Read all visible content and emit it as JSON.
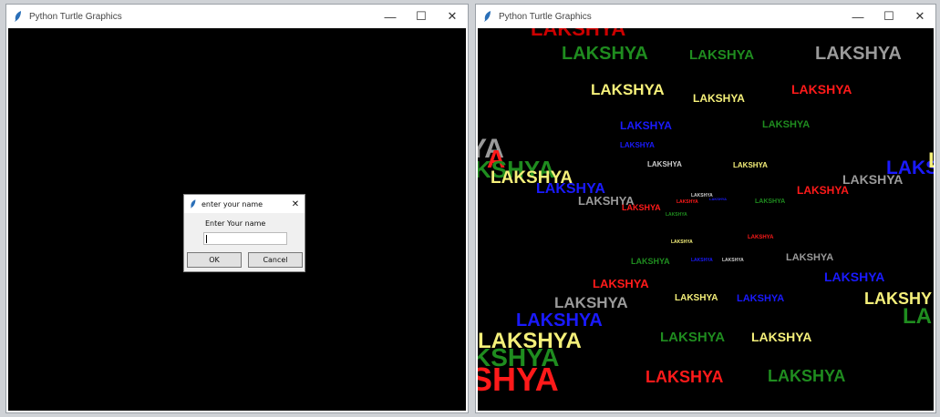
{
  "left_window": {
    "title": "Python Turtle Graphics",
    "minimize": "—",
    "maximize": "☐",
    "close": "✕",
    "dialog": {
      "title": "enter your name",
      "close": "✕",
      "label": "Enter Your name",
      "input_value": "",
      "ok_label": "OK",
      "cancel_label": "Cancel"
    }
  },
  "right_window": {
    "title": "Python Turtle Graphics",
    "minimize": "—",
    "maximize": "☐",
    "close": "✕",
    "words": [
      {
        "text": "LAKSHYA",
        "color": "#cc0000"
      },
      {
        "text": "LAKSHYA",
        "color": "#1f8c1f"
      },
      {
        "text": "LAKSHYA",
        "color": "#1f8c1f"
      },
      {
        "text": "LAKSHYA",
        "color": "#9a9a9a"
      },
      {
        "text": "LAKSHYA",
        "color": "#f5f07a"
      },
      {
        "text": "LAKSHYA",
        "color": "#f5f07a"
      },
      {
        "text": "LAKSHYA",
        "color": "#ff1a1a"
      },
      {
        "text": "LAKSHYA",
        "color": "#1a1aff"
      },
      {
        "text": "LAKSHYA",
        "color": "#1f8c1f"
      },
      {
        "text": "LAKSHYA",
        "color": "#1a1aff"
      },
      {
        "text": "LAKSHYA",
        "color": "#cccccc"
      },
      {
        "text": "LAKSHYA",
        "color": "#f5f07a"
      },
      {
        "text": "YA",
        "color": "#9a9a9a"
      },
      {
        "text": "A",
        "color": "#ff1a1a"
      },
      {
        "text": "KSHYA",
        "color": "#1f8c1f"
      },
      {
        "text": "LAKSHYA",
        "color": "#f5f07a"
      },
      {
        "text": "LAKSHYA",
        "color": "#1a1aff"
      },
      {
        "text": "LAKSHYA",
        "color": "#9a9a9a"
      },
      {
        "text": "LAKS",
        "color": "#1a1aff"
      },
      {
        "text": "L",
        "color": "#f5f07a"
      },
      {
        "text": "LAKSHYA",
        "color": "#9a9a9a"
      },
      {
        "text": "LAKSHYA",
        "color": "#ff1a1a"
      },
      {
        "text": "LAKSHYA",
        "color": "#ff1a1a"
      },
      {
        "text": "LAKSHYA",
        "color": "#1f8c1f"
      },
      {
        "text": "LAKSHYA",
        "color": "#cccccc"
      },
      {
        "text": "LAKSHYA",
        "color": "#1a1aff"
      },
      {
        "text": "LAKSHYA",
        "color": "#ff1a1a"
      },
      {
        "text": "LAKSHYA",
        "color": "#1f8c1f"
      },
      {
        "text": "LAKSHYA",
        "color": "#f5f07a"
      },
      {
        "text": "LAKSHYA",
        "color": "#ff1a1a"
      },
      {
        "text": "LAKSHYA",
        "color": "#1f8c1f"
      },
      {
        "text": "LAKSHYA",
        "color": "#1a1aff"
      },
      {
        "text": "LAKSHYA",
        "color": "#cccccc"
      },
      {
        "text": "LAKSHYA",
        "color": "#9a9a9a"
      },
      {
        "text": "LAKSHYA",
        "color": "#1a1aff"
      },
      {
        "text": "LAKSHYA",
        "color": "#ff1a1a"
      },
      {
        "text": "LAKSHYA",
        "color": "#9a9a9a"
      },
      {
        "text": "LAKSHYA",
        "color": "#f5f07a"
      },
      {
        "text": "LAKSHYA",
        "color": "#1a1aff"
      },
      {
        "text": "LAKSHY",
        "color": "#f5f07a"
      },
      {
        "text": "LA",
        "color": "#1f8c1f"
      },
      {
        "text": "LAKSHYA",
        "color": "#1a1aff"
      },
      {
        "text": "LAKSHYA",
        "color": "#f5f07a"
      },
      {
        "text": "LAKSHYA",
        "color": "#1f8c1f"
      },
      {
        "text": "LAKSHYA",
        "color": "#f5f07a"
      },
      {
        "text": "KSHYA",
        "color": "#1f8c1f"
      },
      {
        "text": "SHYA",
        "color": "#ff1a1a"
      },
      {
        "text": "LAKSHYA",
        "color": "#ff1a1a"
      },
      {
        "text": "LAKSHYA",
        "color": "#1f8c1f"
      }
    ]
  }
}
